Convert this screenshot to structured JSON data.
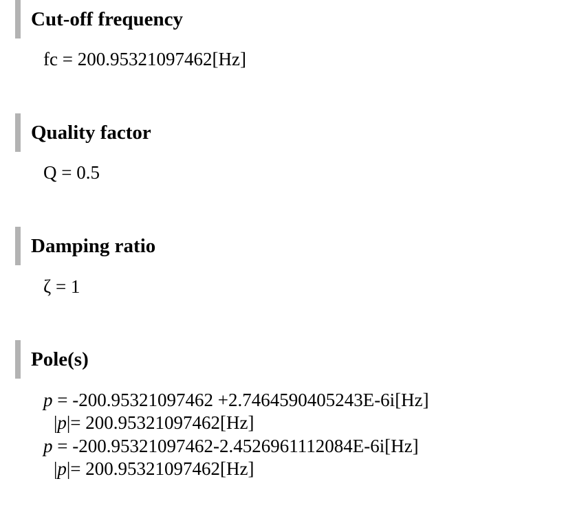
{
  "sections": {
    "cutoff": {
      "title": "Cut-off frequency",
      "symbol": "fc",
      "eq": " = ",
      "value": "200.95321097462[Hz]"
    },
    "quality": {
      "title": "Quality factor",
      "symbol": "Q",
      "eq": " = ",
      "value": "0.5"
    },
    "damping": {
      "title": "Damping ratio",
      "symbol": "ζ",
      "eq": " = ",
      "value": "1"
    },
    "poles": {
      "title": "Pole(s)",
      "items": [
        {
          "symbol": "p",
          "eq": " = ",
          "value": "-200.95321097462 +2.7464590405243E-6i[Hz]",
          "abs_open": "|",
          "abs_symbol": "p",
          "abs_close": "|= ",
          "abs_value": "200.95321097462[Hz]"
        },
        {
          "symbol": "p",
          "eq": " = ",
          "value": "-200.95321097462-2.4526961112084E-6i[Hz]",
          "abs_open": "|",
          "abs_symbol": "p",
          "abs_close": "|= ",
          "abs_value": "200.95321097462[Hz]"
        }
      ]
    }
  }
}
